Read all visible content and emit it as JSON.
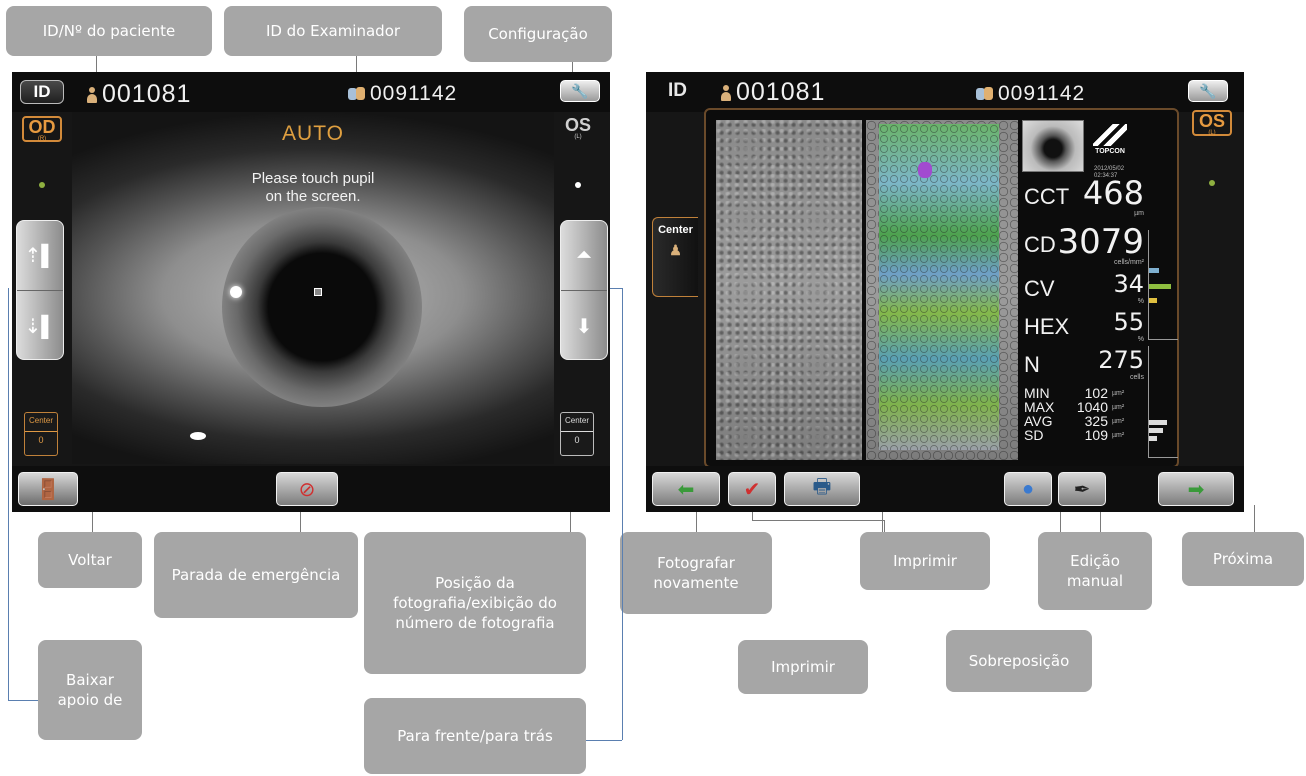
{
  "left_screen": {
    "id_button": "ID",
    "patient_id": "001081",
    "examiner_id": "0091142",
    "eye_right": "OD",
    "eye_right_sub": "(R)",
    "eye_left": "OS",
    "eye_left_sub": "(L)",
    "mode": "AUTO",
    "instruction_line1": "Please touch pupil",
    "instruction_line2": "on the screen.",
    "center_label": "Center",
    "photo_count_left": "0",
    "photo_count_right": "0"
  },
  "right_screen": {
    "id_label": "ID",
    "patient_id": "001081",
    "examiner_id": "0091142",
    "eye_left": "OS",
    "eye_left_sub": "(L)",
    "center_tab": "Center",
    "brand": "TOPCON",
    "date_line1": "2012/05/02",
    "date_line2": "02:34:37",
    "metrics": {
      "cct_label": "CCT",
      "cct_value": "468",
      "cct_unit": "µm",
      "cd_label": "CD",
      "cd_value": "3079",
      "cd_unit": "cells/mm²",
      "cv_label": "CV",
      "cv_value": "34",
      "cv_unit": "%",
      "hex_label": "HEX",
      "hex_value": "55",
      "hex_unit": "%",
      "n_label": "N",
      "n_value": "275",
      "n_unit": "cells",
      "min_label": "MIN",
      "min_value": "102",
      "min_unit": "µm²",
      "max_label": "MAX",
      "max_value": "1040",
      "max_unit": "µm²",
      "avg_label": "AVG",
      "avg_value": "325",
      "avg_unit": "µm²",
      "sd_label": "SD",
      "sd_value": "109",
      "sd_unit": "µm²"
    }
  },
  "callouts": {
    "patient_id": "ID/Nº do paciente",
    "examiner_id": "ID do Examinador",
    "config": "Configuração",
    "back": "Voltar",
    "emergency_stop": "Parada de emergência",
    "photo_position": "Posição da fotografia/exibição do número de fotografia",
    "lower_chinrest": "Baixar apoio de",
    "forward_back": "Para frente/para trás",
    "retake": "Fotografar novamente",
    "print_top": "Imprimir",
    "print_bottom": "Imprimir",
    "manual_edit": "Edição manual",
    "next": "Próxima",
    "overlay": "Sobreposição"
  },
  "colors": {
    "callout_bg": "#a6a6a6",
    "accent_orange": "#e69a40",
    "screen_bg": "#161616"
  }
}
